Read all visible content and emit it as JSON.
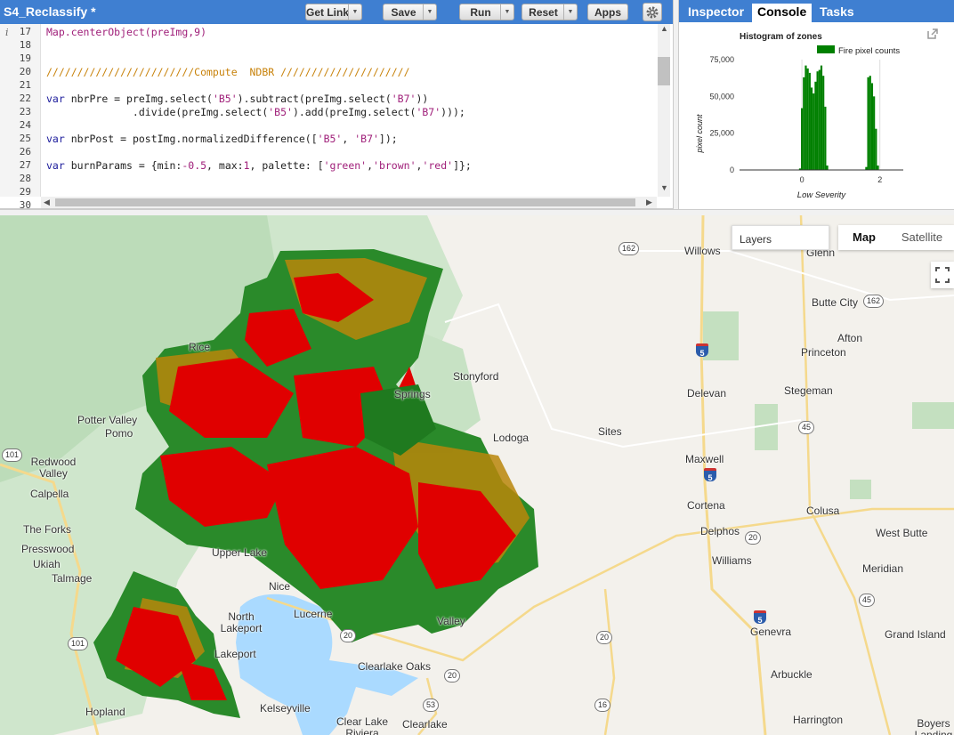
{
  "toolbar": {
    "script_title": "S4_Reclassify *",
    "get_link": "Get Link",
    "save": "Save",
    "run": "Run",
    "reset": "Reset",
    "apps": "Apps"
  },
  "editor": {
    "line_numbers": [
      "17",
      "18",
      "19",
      "20",
      "21",
      "22",
      "23",
      "24",
      "25",
      "26",
      "27",
      "28",
      "29",
      "30"
    ]
  },
  "panel": {
    "tabs": [
      "Inspector",
      "Console",
      "Tasks"
    ],
    "active_tab": "Console"
  },
  "chart_data": {
    "type": "bar",
    "title": "Histogram of zones",
    "xlabel": "Low Severity",
    "ylabel": "pixel count",
    "x_ticks": [
      "0",
      "2"
    ],
    "y_ticks": [
      "0",
      "25,000",
      "50,000",
      "75,000"
    ],
    "ylim": [
      0,
      75000
    ],
    "xlim": [
      -1.6,
      2.6
    ],
    "legend": "top-right",
    "series": [
      {
        "name": "Fire pixel counts",
        "color": "#008000",
        "x": [
          -0.05,
          0.0,
          0.05,
          0.1,
          0.15,
          0.2,
          0.25,
          0.3,
          0.35,
          0.4,
          0.45,
          0.5,
          0.55,
          0.6,
          0.65,
          1.65,
          1.7,
          1.75,
          1.8,
          1.85,
          1.9,
          1.95
        ],
        "values": [
          1000,
          42000,
          63000,
          71000,
          69000,
          66000,
          56000,
          52000,
          60000,
          67000,
          68000,
          71000,
          64000,
          43000,
          3000,
          2000,
          63000,
          64000,
          59000,
          50000,
          28000,
          3000
        ]
      }
    ]
  },
  "map": {
    "places": [
      {
        "name": "Willows"
      },
      {
        "name": "Glenn"
      },
      {
        "name": "Butte City"
      },
      {
        "name": "Afton"
      },
      {
        "name": "Princeton"
      },
      {
        "name": "Stonyford"
      },
      {
        "name": "Delevan"
      },
      {
        "name": "Stegeman"
      },
      {
        "name": "Potter Valley"
      },
      {
        "name": "Pomo"
      },
      {
        "name": "Springs"
      },
      {
        "name": "Lodoga"
      },
      {
        "name": "Sites"
      },
      {
        "name": "Redwood Valley"
      },
      {
        "name": "Maxwell"
      },
      {
        "name": "Calpella"
      },
      {
        "name": "Cortena"
      },
      {
        "name": "Colusa"
      },
      {
        "name": "The Forks"
      },
      {
        "name": "Presswood"
      },
      {
        "name": "Delphos"
      },
      {
        "name": "West Butte"
      },
      {
        "name": "Ukiah"
      },
      {
        "name": "Upper Lake"
      },
      {
        "name": "Williams"
      },
      {
        "name": "Talmage"
      },
      {
        "name": "Meridian"
      },
      {
        "name": "Nice"
      },
      {
        "name": "Lucerne"
      },
      {
        "name": "North Lakeport"
      },
      {
        "name": "Genevra"
      },
      {
        "name": "Grand Island"
      },
      {
        "name": "Lakeport"
      },
      {
        "name": "Clearlake Oaks"
      },
      {
        "name": "Arbuckle"
      },
      {
        "name": "Hopland"
      },
      {
        "name": "Kelseyville"
      },
      {
        "name": "Harrington"
      },
      {
        "name": "Clear Lake Riviera"
      },
      {
        "name": "Clearlake"
      },
      {
        "name": "Boyers Landing"
      },
      {
        "name": "Rice"
      },
      {
        "name": "Valley"
      }
    ],
    "routes": [
      "162",
      "162",
      "5",
      "45",
      "45",
      "101",
      "5",
      "20",
      "20",
      "101",
      "5",
      "20",
      "20",
      "53",
      "16"
    ],
    "layers_label": "Layers",
    "map_type_active": "Map",
    "map_type_other": "Satellite"
  }
}
